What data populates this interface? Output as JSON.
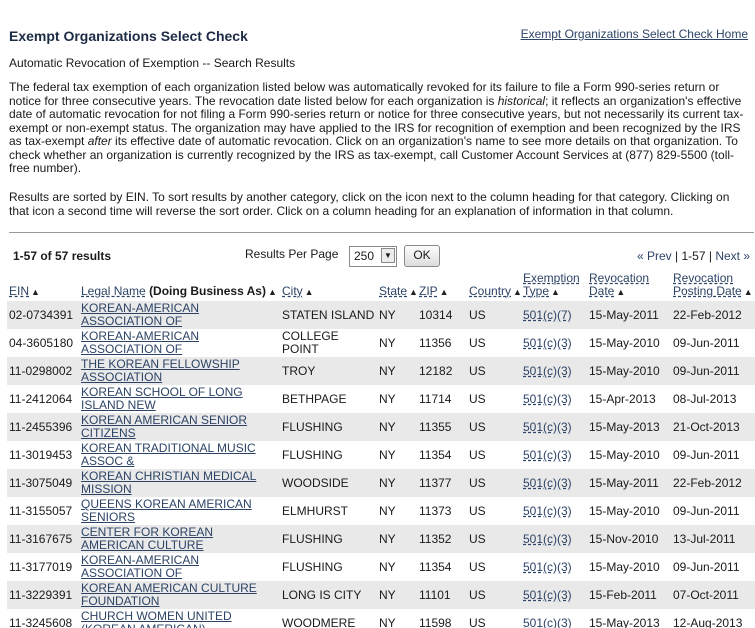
{
  "header": {
    "title": "Exempt Organizations Select Check",
    "home_link": "Exempt Organizations Select Check Home",
    "subtitle": "Automatic Revocation of Exemption -- Search Results"
  },
  "intro": {
    "p1_a": "The federal tax exemption of each organization listed below was automatically revoked for its failure to file a Form 990-series return or notice for three consecutive years. The revocation date listed below for each organization is ",
    "p1_italic1": "historical",
    "p1_b": "; it reflects an organization's effective date of automatic revocation for not filing a Form 990-series return or notice for three consecutive years, but not necessarily its current tax-exempt or non-exempt status. The organization may have applied to the IRS for recognition of exemption and been recognized by the IRS as tax-exempt ",
    "p1_italic2": "after",
    "p1_c": " its effective date of automatic revocation. Click on an organization's name to see more details on that organization. To check whether an organization is currently recognized by the IRS as tax-exempt, call Customer Account Services at (877) 829-5500 (toll-free number).",
    "p2": "Results are sorted by EIN. To sort results by another category, click on the icon next to the column heading for that category. Clicking on that icon a second time will reverse the sort order. Click on a column heading for an explanation of information in that column."
  },
  "controls": {
    "count": "1-57 of 57 results",
    "rpp_label": "Results Per Page",
    "rpp_value": "250",
    "ok_label": "OK",
    "prev": "« Prev",
    "range": "1-57",
    "next": "Next »"
  },
  "columns": {
    "ein": "EIN",
    "legal_name": "Legal Name",
    "dba": "(Doing Business As)",
    "city": "City",
    "state": "State",
    "zip": "ZIP",
    "country": "Country",
    "exemption_type_1": "Exemption",
    "exemption_type_2": "Type",
    "revocation_date_1": "Revocation",
    "revocation_date_2": "Date",
    "posting_date_1": "Revocation",
    "posting_date_2": "Posting Date"
  },
  "rows": [
    {
      "ein": "02-0734391",
      "name": "KOREAN-AMERICAN ASSOCIATION OF",
      "city": "STATEN ISLAND",
      "state": "NY",
      "zip": "10314",
      "country": "US",
      "type": "501(c)(7)",
      "rev": "15-May-2011",
      "post": "22-Feb-2012"
    },
    {
      "ein": "04-3605180",
      "name": "KOREAN-AMERICAN ASSOCIATION OF",
      "city": "COLLEGE POINT",
      "state": "NY",
      "zip": "11356",
      "country": "US",
      "type": "501(c)(3)",
      "rev": "15-May-2010",
      "post": "09-Jun-2011"
    },
    {
      "ein": "11-0298002",
      "name": "THE KOREAN FELLOWSHIP ASSOCIATION",
      "city": "TROY",
      "state": "NY",
      "zip": "12182",
      "country": "US",
      "type": "501(c)(3)",
      "rev": "15-May-2010",
      "post": "09-Jun-2011"
    },
    {
      "ein": "11-2412064",
      "name": "KOREAN SCHOOL OF LONG ISLAND NEW",
      "city": "BETHPAGE",
      "state": "NY",
      "zip": "11714",
      "country": "US",
      "type": "501(c)(3)",
      "rev": "15-Apr-2013",
      "post": "08-Jul-2013"
    },
    {
      "ein": "11-2455396",
      "name": "KOREAN AMERICAN SENIOR CITIZENS",
      "city": "FLUSHING",
      "state": "NY",
      "zip": "11355",
      "country": "US",
      "type": "501(c)(3)",
      "rev": "15-May-2013",
      "post": "21-Oct-2013"
    },
    {
      "ein": "11-3019453",
      "name": "KOREAN TRADITIONAL MUSIC ASSOC &",
      "city": "FLUSHING",
      "state": "NY",
      "zip": "11354",
      "country": "US",
      "type": "501(c)(3)",
      "rev": "15-May-2010",
      "post": "09-Jun-2011"
    },
    {
      "ein": "11-3075049",
      "name": "KOREAN CHRISTIAN MEDICAL MISSION",
      "city": "WOODSIDE",
      "state": "NY",
      "zip": "11377",
      "country": "US",
      "type": "501(c)(3)",
      "rev": "15-May-2011",
      "post": "22-Feb-2012"
    },
    {
      "ein": "11-3155057",
      "name": "QUEENS KOREAN AMERICAN SENIORS",
      "city": "ELMHURST",
      "state": "NY",
      "zip": "11373",
      "country": "US",
      "type": "501(c)(3)",
      "rev": "15-May-2010",
      "post": "09-Jun-2011"
    },
    {
      "ein": "11-3167675",
      "name": "CENTER FOR KOREAN AMERICAN CULTURE",
      "city": "FLUSHING",
      "state": "NY",
      "zip": "11352",
      "country": "US",
      "type": "501(c)(3)",
      "rev": "15-Nov-2010",
      "post": "13-Jul-2011"
    },
    {
      "ein": "11-3177019",
      "name": "KOREAN-AMERICAN ASSOCIATION OF",
      "city": "FLUSHING",
      "state": "NY",
      "zip": "11354",
      "country": "US",
      "type": "501(c)(3)",
      "rev": "15-May-2010",
      "post": "09-Jun-2011"
    },
    {
      "ein": "11-3229391",
      "name": "KOREAN AMERICAN CULTURE FOUNDATION",
      "city": "LONG IS CITY",
      "state": "NY",
      "zip": "11101",
      "country": "US",
      "type": "501(c)(3)",
      "rev": "15-Feb-2011",
      "post": "07-Oct-2011"
    },
    {
      "ein": "11-3245608",
      "name": "CHURCH WOMEN UNITED (KOREAN AMERICAN)",
      "city": "WOODMERE",
      "state": "NY",
      "zip": "11598",
      "country": "US",
      "type": "501(c)(3)",
      "rev": "15-May-2013",
      "post": "12-Aug-2013"
    }
  ]
}
